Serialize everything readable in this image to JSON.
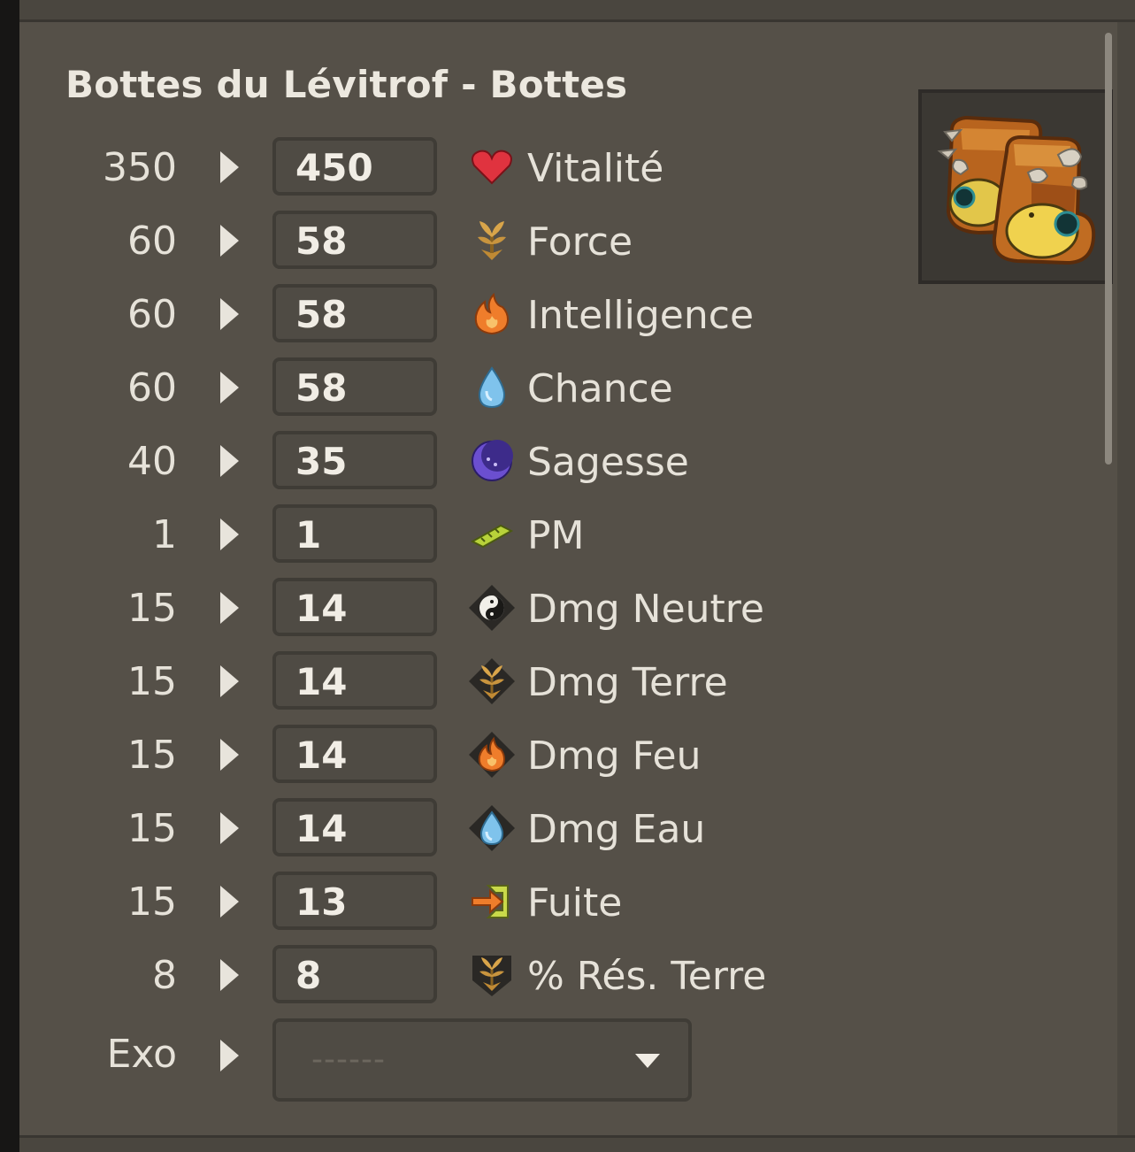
{
  "item": {
    "title": "Bottes du Lévitrof - Bottes",
    "image_icon": "boots-image"
  },
  "stats": [
    {
      "base": "350",
      "value": "450",
      "icon": "heart-icon",
      "name": "Vitalité"
    },
    {
      "base": "60",
      "value": "58",
      "icon": "earth-sprout-icon",
      "name": "Force"
    },
    {
      "base": "60",
      "value": "58",
      "icon": "fire-icon",
      "name": "Intelligence"
    },
    {
      "base": "60",
      "value": "58",
      "icon": "water-drop-icon",
      "name": "Chance"
    },
    {
      "base": "40",
      "value": "35",
      "icon": "moon-icon",
      "name": "Sagesse"
    },
    {
      "base": "1",
      "value": "1",
      "icon": "mp-boot-icon",
      "name": "PM"
    },
    {
      "base": "15",
      "value": "14",
      "icon": "neutral-yinyang-icon",
      "name": "Dmg Neutre"
    },
    {
      "base": "15",
      "value": "14",
      "icon": "earth-damage-icon",
      "name": "Dmg Terre"
    },
    {
      "base": "15",
      "value": "14",
      "icon": "fire-damage-icon",
      "name": "Dmg Feu"
    },
    {
      "base": "15",
      "value": "14",
      "icon": "water-damage-icon",
      "name": "Dmg Eau"
    },
    {
      "base": "15",
      "value": "13",
      "icon": "flee-arrow-icon",
      "name": "Fuite"
    },
    {
      "base": "8",
      "value": "8",
      "icon": "earth-resistance-icon",
      "name": "% Rés. Terre"
    }
  ],
  "exo": {
    "label": "Exo",
    "placeholder": "------"
  },
  "colors": {
    "panel": "#555048",
    "text": "#e6e2d9",
    "input_border": "#3f3c36"
  }
}
